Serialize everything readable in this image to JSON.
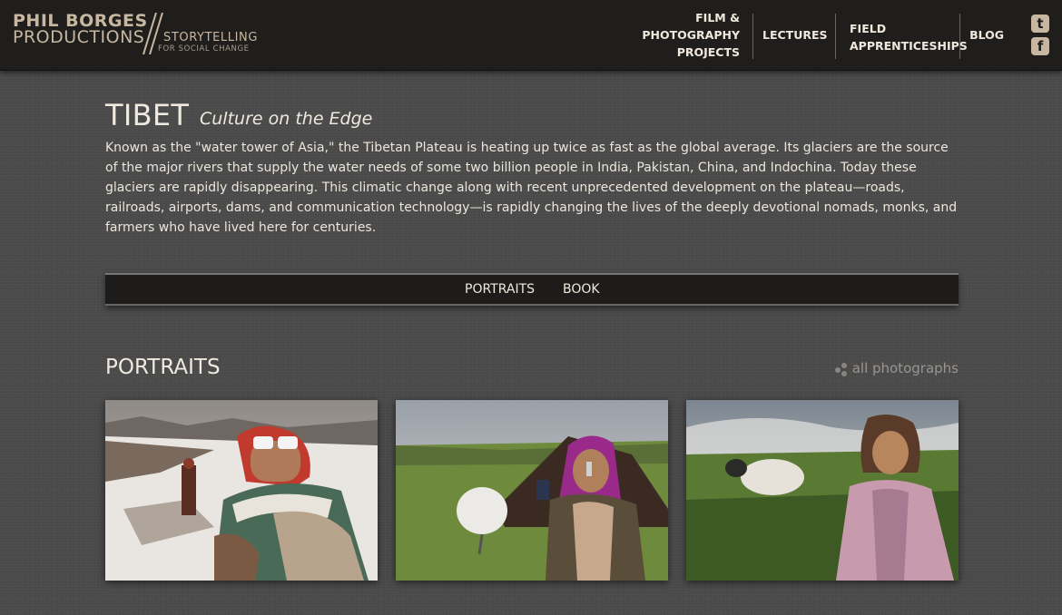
{
  "header": {
    "logo": {
      "line1": "PHIL BORGES",
      "line2": "PRODUCTIONS",
      "tagline1": "STORYTELLING",
      "tagline2": "FOR SOCIAL CHANGE"
    },
    "nav": [
      {
        "lines": [
          "FILM &",
          "PHOTOGRAPHY",
          "PROJECTS"
        ]
      },
      {
        "lines": [
          "LECTURES"
        ]
      },
      {
        "lines": [
          "FIELD",
          "APPRENTICESHIPS"
        ]
      },
      {
        "lines": [
          "BLOG"
        ]
      }
    ],
    "social": {
      "twitter_icon": "twitter-icon",
      "facebook_icon": "facebook-icon",
      "twitter_glyph": "t",
      "facebook_glyph": "f"
    }
  },
  "main": {
    "title": "TIBET",
    "subtitle": "Culture on the Edge",
    "intro": "Known as the \"water tower of Asia,\" the Tibetan Plateau is heating up twice as fast as the global average. Its glaciers are the source of the major rivers that supply the water needs of some two billion people in India, Pakistan, China, and Indochina. Today these glaciers are rapidly disappearing. This climatic change along with recent unprecedented development on the plateau—roads, railroads, airports, dams, and communication technology—is rapidly changing the lives of the deeply devotional nomads, monks, and farmers who have lived here for centuries.",
    "subnav": [
      "PORTRAITS",
      "BOOK"
    ],
    "section": {
      "title": "PORTRAITS",
      "all_link": "all photographs"
    }
  },
  "colors": {
    "accent": "#c8b7a0",
    "header_bg": "#1f1e1d",
    "page_bg": "#4a4a4a"
  }
}
